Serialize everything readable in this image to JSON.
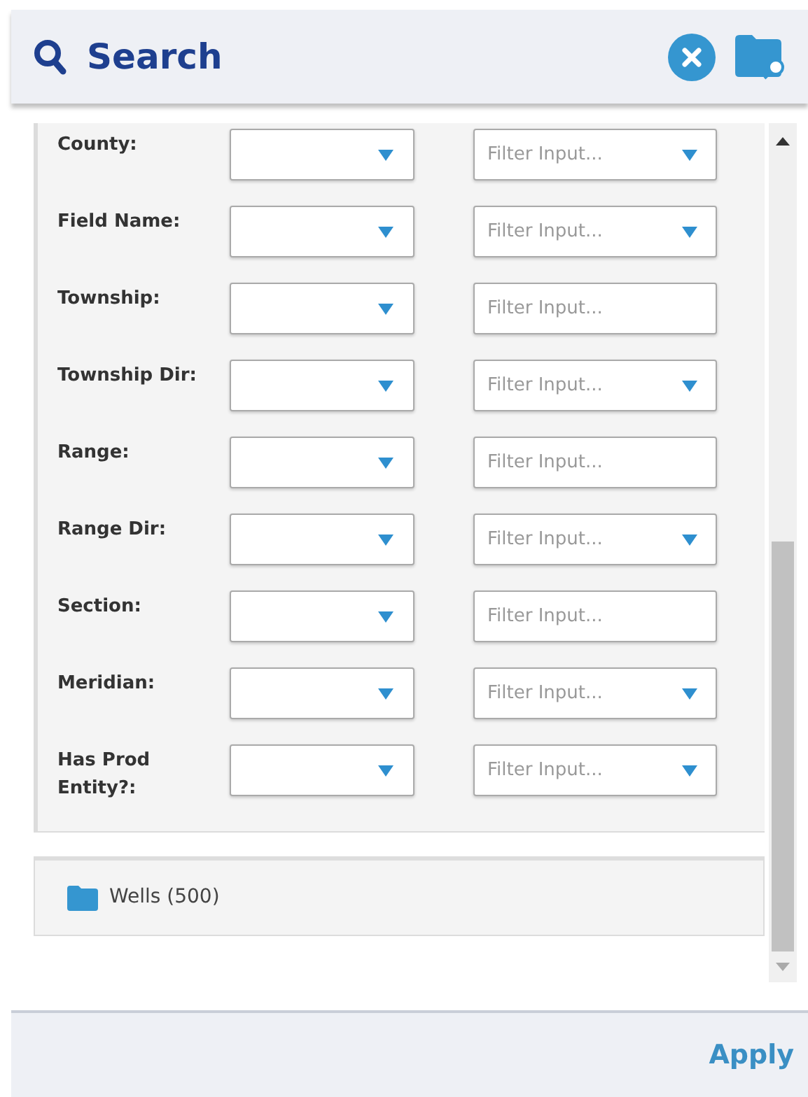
{
  "header": {
    "title": "Search"
  },
  "fields": [
    {
      "label": "County:",
      "kind": "dropdown",
      "filter_placeholder": "Filter Input..."
    },
    {
      "label": "Field Name:",
      "kind": "dropdown",
      "filter_placeholder": "Filter Input..."
    },
    {
      "label": "Township:",
      "kind": "text",
      "filter_placeholder": "Filter Input..."
    },
    {
      "label": "Township Dir:",
      "kind": "dropdown",
      "filter_placeholder": "Filter Input..."
    },
    {
      "label": "Range:",
      "kind": "text",
      "filter_placeholder": "Filter Input..."
    },
    {
      "label": "Range Dir:",
      "kind": "dropdown",
      "filter_placeholder": "Filter Input..."
    },
    {
      "label": "Section:",
      "kind": "text",
      "filter_placeholder": "Filter Input..."
    },
    {
      "label": "Meridian:",
      "kind": "dropdown",
      "filter_placeholder": "Filter Input..."
    },
    {
      "label": "Has Prod Entity?:",
      "kind": "dropdown",
      "filter_placeholder": "Filter Input..."
    }
  ],
  "results": [
    {
      "label": "Wells (500)"
    }
  ],
  "footer": {
    "apply": "Apply"
  }
}
